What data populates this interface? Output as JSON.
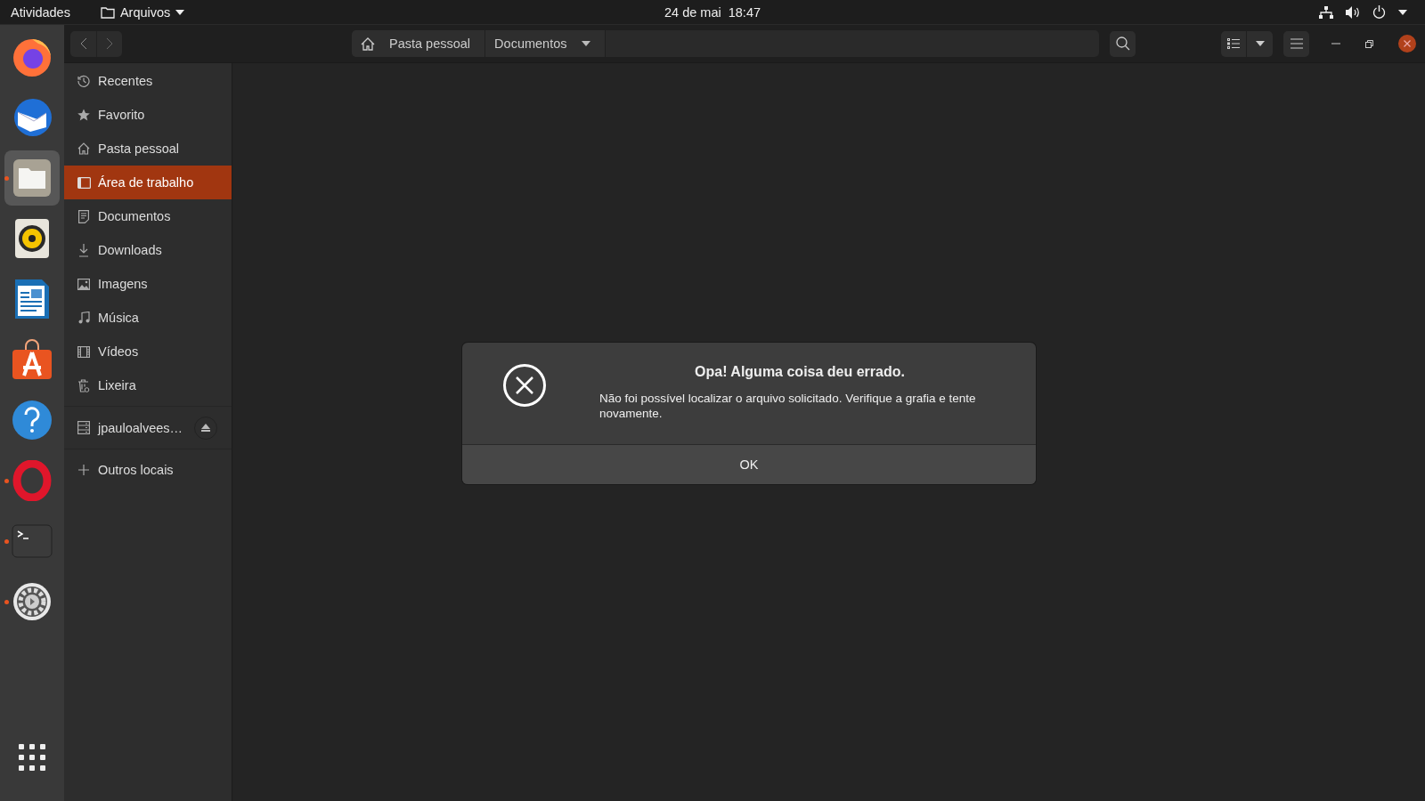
{
  "top_bar": {
    "activities": "Atividades",
    "app_menu": "Arquivos",
    "clock": "24 de mai  18:47"
  },
  "dock": [
    {
      "kind": "firefox",
      "running": false,
      "focused": false
    },
    {
      "kind": "thunderbird",
      "running": false,
      "focused": false
    },
    {
      "kind": "files",
      "running": true,
      "focused": true
    },
    {
      "kind": "rhythmbox",
      "running": false,
      "focused": false
    },
    {
      "kind": "writer",
      "running": false,
      "focused": false
    },
    {
      "kind": "software",
      "running": false,
      "focused": false
    },
    {
      "kind": "help",
      "running": false,
      "focused": false
    },
    {
      "kind": "opera",
      "running": true,
      "focused": false
    },
    {
      "kind": "terminal",
      "running": true,
      "focused": false
    },
    {
      "kind": "settings",
      "running": true,
      "focused": false
    }
  ],
  "path_bar": [
    {
      "label": "Pasta pessoal",
      "kind": "home"
    },
    {
      "label": "Documentos",
      "kind": "folder"
    }
  ],
  "sidebar": {
    "places": [
      {
        "label": "Recentes",
        "kind": "recent",
        "selected": false
      },
      {
        "label": "Favorito",
        "kind": "star",
        "selected": false
      },
      {
        "label": "Pasta pessoal",
        "kind": "home",
        "selected": false
      },
      {
        "label": "Área de trabalho",
        "kind": "desktop",
        "selected": true
      },
      {
        "label": "Documentos",
        "kind": "document",
        "selected": false
      },
      {
        "label": "Downloads",
        "kind": "download",
        "selected": false
      },
      {
        "label": "Imagens",
        "kind": "image",
        "selected": false
      },
      {
        "label": "Música",
        "kind": "music",
        "selected": false
      },
      {
        "label": "Vídeos",
        "kind": "video",
        "selected": false
      },
      {
        "label": "Lixeira",
        "kind": "trash",
        "selected": false
      }
    ],
    "devices": [
      {
        "label": "jpauloalvees…"
      }
    ],
    "other": {
      "label": "Outros locais"
    }
  },
  "dialog": {
    "title": "Opa! Alguma coisa deu errado.",
    "message": "Não foi possível localizar o arquivo solicitado. Verifique a grafia e tente novamente.",
    "button": "OK"
  }
}
